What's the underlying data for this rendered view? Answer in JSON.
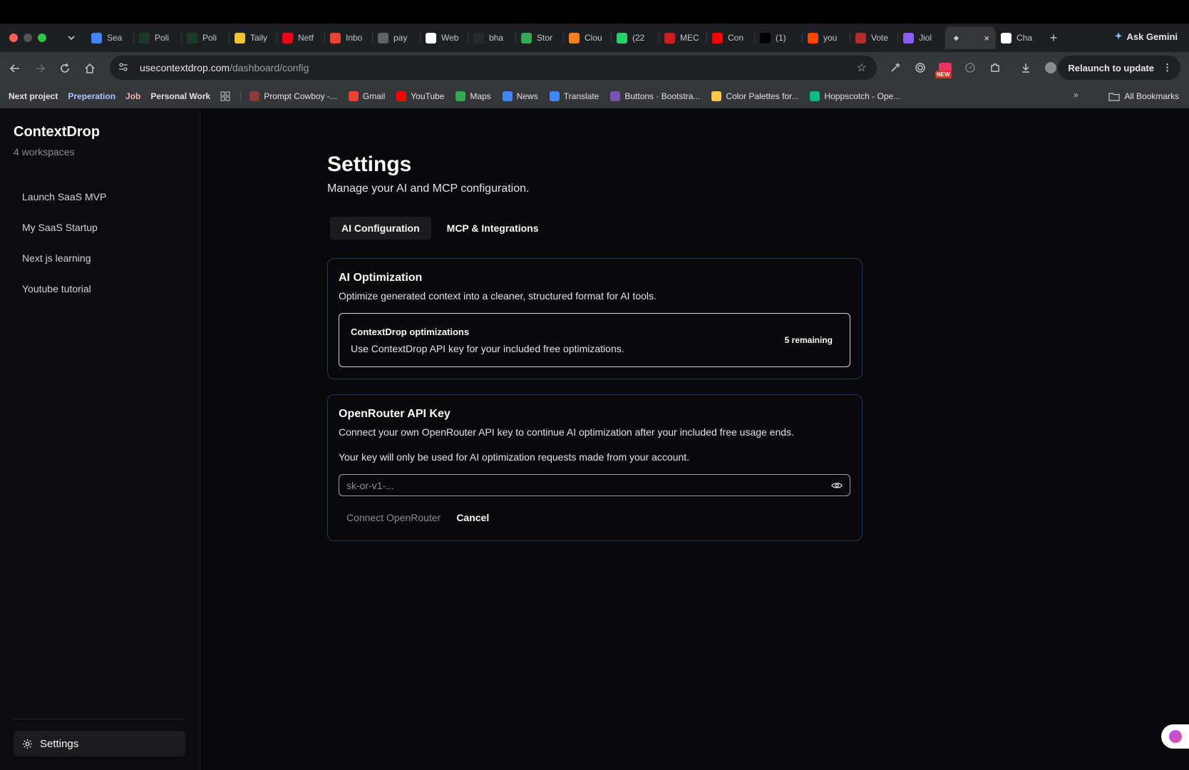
{
  "browser": {
    "tabs": [
      {
        "label": "Sea",
        "fav": "#4285f4",
        "icon": "search-tab-icon"
      },
      {
        "label": "Poli",
        "fav": "#1a3a2a",
        "icon": "bolt-tab-icon"
      },
      {
        "label": "Poli",
        "fav": "#1a3a2a",
        "icon": "bolt-tab-icon"
      },
      {
        "label": "Taily",
        "fav": "#f4c430",
        "icon": "note-tab-icon"
      },
      {
        "label": "Netf",
        "fav": "#e50914",
        "icon": "netflix-tab-icon"
      },
      {
        "label": "Inbo",
        "fav": "#ea4335",
        "icon": "gmail-tab-icon"
      },
      {
        "label": "pay",
        "fav": "#5f6368",
        "icon": "globe-tab-icon"
      },
      {
        "label": "Web",
        "fav": "#ffffff",
        "icon": "web-tab-icon"
      },
      {
        "label": "bha",
        "fav": "#24292e",
        "icon": "github-tab-icon"
      },
      {
        "label": "Stor",
        "fav": "#34a853",
        "icon": "drive-tab-icon"
      },
      {
        "label": "Clou",
        "fav": "#f38020",
        "icon": "cloud-tab-icon"
      },
      {
        "label": "(22",
        "fav": "#25d366",
        "icon": "chat-tab-icon"
      },
      {
        "label": "MEC",
        "fav": "#c5221f",
        "icon": "mail-tab-icon"
      },
      {
        "label": "Con",
        "fav": "#ff0000",
        "icon": "youtube-tab-icon"
      },
      {
        "label": "(1)",
        "fav": "#000000",
        "icon": "x-tab-icon"
      },
      {
        "label": "you",
        "fav": "#ff4500",
        "icon": "reddit-tab-icon"
      },
      {
        "label": "Vote",
        "fav": "#b32d2e",
        "icon": "shield-tab-icon"
      },
      {
        "label": "Jiol",
        "fav": "#8b5cf6",
        "icon": "jio-tab-icon"
      }
    ],
    "active_tab": {
      "label": "",
      "close": "×"
    },
    "after_tab": {
      "label": "Cha",
      "fav": "#ffffff",
      "icon": "openai-tab-icon"
    },
    "new_tab": "+",
    "ask_gemini": "Ask Gemini",
    "url_host": "usecontextdrop.com",
    "url_path": "/dashboard/config",
    "relaunch": "Relaunch to update",
    "new_badge": "NEW",
    "bookmarks_left": [
      "Next project",
      "Preperation",
      "Job",
      "Personal Work"
    ],
    "bookmarks": [
      {
        "label": "Prompt Cowboy -...",
        "fav": "#8b3a3a",
        "icon": "cowboy-bookmark-icon"
      },
      {
        "label": "Gmail",
        "fav": "#ea4335",
        "icon": "gmail-bookmark-icon"
      },
      {
        "label": "YouTube",
        "fav": "#ff0000",
        "icon": "youtube-bookmark-icon"
      },
      {
        "label": "Maps",
        "fav": "#34a853",
        "icon": "maps-bookmark-icon"
      },
      {
        "label": "News",
        "fav": "#4285f4",
        "icon": "news-bookmark-icon"
      },
      {
        "label": "Translate",
        "fav": "#4285f4",
        "icon": "translate-bookmark-icon"
      },
      {
        "label": "Buttons · Bootstra...",
        "fav": "#7952b3",
        "icon": "bootstrap-bookmark-icon"
      },
      {
        "label": "Color Palettes for...",
        "fav": "#f9c74f",
        "icon": "palette-bookmark-icon"
      },
      {
        "label": "Hoppscotch - Ope...",
        "fav": "#10b981",
        "icon": "hoppscotch-bookmark-icon"
      }
    ],
    "all_bookmarks": "All Bookmarks"
  },
  "sidebar": {
    "brand": "ContextDrop",
    "subtitle": "4 workspaces",
    "workspaces": [
      "Launch SaaS MVP",
      "My SaaS Startup",
      "Next js learning",
      "Youtube tutorial"
    ],
    "settings_label": "Settings"
  },
  "main": {
    "title": "Settings",
    "subtitle": "Manage your AI and MCP configuration.",
    "tabs": [
      "AI Configuration",
      "MCP & Integrations"
    ],
    "ai_optimization": {
      "title": "AI Optimization",
      "desc": "Optimize generated context into a cleaner, structured format for AI tools.",
      "option_title": "ContextDrop optimizations",
      "option_desc": "Use ContextDrop API key for your included free optimizations.",
      "remaining": "5 remaining"
    },
    "openrouter": {
      "title": "OpenRouter API Key",
      "desc": "Connect your own OpenRouter API key to continue AI optimization after your included free usage ends.",
      "note": "Your key will only be used for AI optimization requests made from your account.",
      "placeholder": "sk-or-v1-...",
      "connect_label": "Connect OpenRouter",
      "cancel_label": "Cancel"
    }
  },
  "colors": {
    "card_border": "#1e3a5f",
    "background": "#09090b"
  }
}
